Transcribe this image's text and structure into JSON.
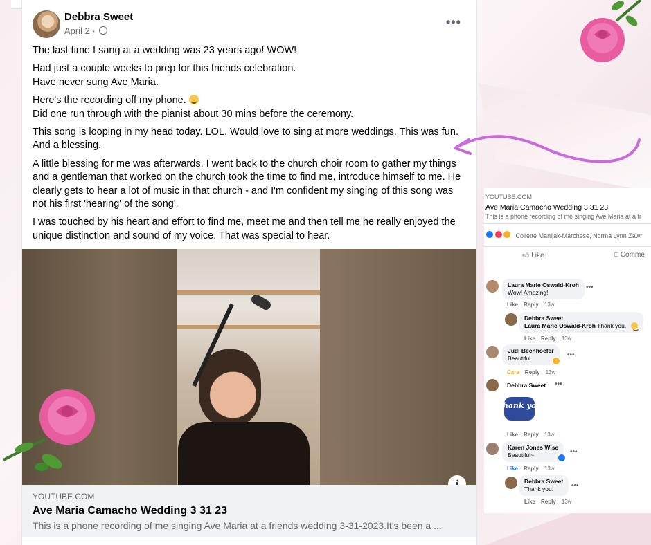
{
  "post": {
    "author": "Debbra Sweet",
    "date": "April 2 · ",
    "more": "•••",
    "paragraphs": [
      "The last time I sang at a wedding was 23 years ago! WOW!",
      "Had just a couple weeks to prep for this friends celebration.\nHave never sung Ave Maria.",
      "Here's the recording off my phone.",
      "Did one run through with the pianist about 30 mins before the ceremony.",
      "This song is looping in my head today.  LOL. Would love to sing at more weddings. This was fun.\nAnd a blessing.",
      "A little blessing for me was afterwards. I went back to the church choir room to gather my things and a gentleman that worked on the church took the time to find me, introduce himself to me. He clearly gets to hear a lot of music in that church - and I'm confident my singing of this song was not his first 'hearing' of the song'.",
      "I was touched by his heart and effort to find me, meet me and then tell me he really enjoyed the unique distinction and sound of my voice.  That was special to hear."
    ],
    "info_label": "i",
    "link": {
      "source": "YOUTUBE.COM",
      "title": "Ave Maria Camacho Wedding 3 31 23",
      "description": "This is a phone recording of me singing Ave Maria at a friends wedding 3-31-2023.It's been a ..."
    }
  },
  "panel": {
    "source": "YOUTUBE.COM",
    "title": "Ave Maria Camacho Wedding 3 31 23",
    "description": "This is a phone recording of me singing Ave Maria at a fr",
    "reactions_text": "Collette Manijak-Marchese, Norma Lynn Zawr",
    "like_label": "Like",
    "comment_label": "Comme",
    "comments": [
      {
        "name": "Laura Marie Oswald-Kroh",
        "text": "Wow! Amazing!",
        "like": "Like",
        "reply": "Reply",
        "time": "13w"
      },
      {
        "name": "Debbra Sweet",
        "tag": "Laura Marie Oswald-Kroh",
        "text": " Thank you.",
        "like": "Like",
        "reply": "Reply",
        "time": "13w"
      },
      {
        "name": "Judi Bechhoefer",
        "text": "Beautiful",
        "like": "Care",
        "reply": "Reply",
        "time": "13w"
      },
      {
        "name": "Debbra Sweet",
        "like": "Like",
        "reply": "Reply",
        "time": "13w"
      },
      {
        "name": "Karen Jones Wise",
        "text": "Beautiful~",
        "like": "Like",
        "reply": "Reply",
        "time": "13w"
      },
      {
        "name": "Debbra Sweet",
        "text": "Thank you.",
        "like": "Like",
        "reply": "Reply",
        "time": "13w"
      }
    ],
    "sticker_text": "Thank you"
  },
  "colors": {
    "accent_purple": "#c86bd8",
    "fb_blue": "#1877f2",
    "care_yellow": "#f7b125",
    "rose_pink": "#e85ca0"
  }
}
